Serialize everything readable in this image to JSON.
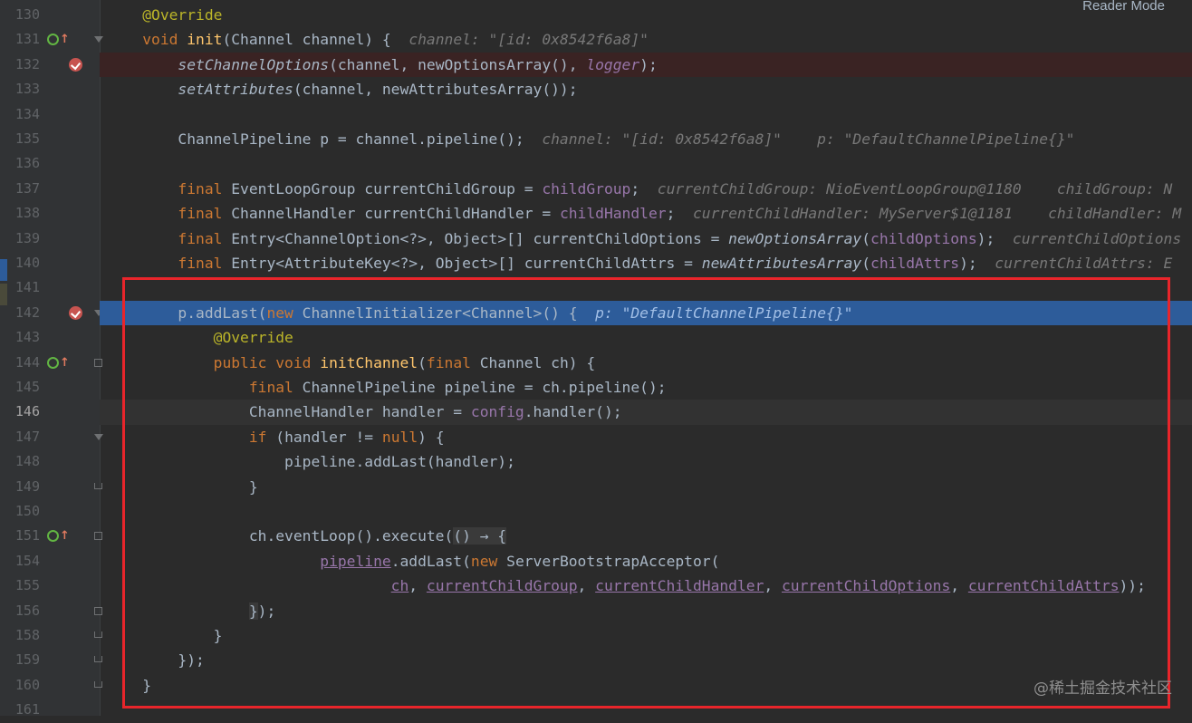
{
  "editor": {
    "reader_mode_label": "Reader Mode",
    "watermark": "@稀土掘金技术社区",
    "colors": {
      "background": "#2b2b2b",
      "keyword": "#cc7832",
      "annotation": "#bbb529",
      "method": "#ffc66d",
      "field": "#9876aa",
      "execution_line": "#2d5c9a",
      "red_box": "#e8252b"
    },
    "line_numbers": [
      "130",
      "131",
      "132",
      "133",
      "134",
      "135",
      "136",
      "137",
      "138",
      "139",
      "140",
      "141",
      "142",
      "143",
      "144",
      "145",
      "146",
      "147",
      "148",
      "149",
      "150",
      "151",
      "154",
      "155",
      "156",
      "158",
      "159",
      "160",
      "161"
    ],
    "lines": [
      [
        {
          "t": "    "
        },
        {
          "t": "@Override",
          "c": "ann"
        }
      ],
      [
        {
          "t": "    "
        },
        {
          "t": "void ",
          "c": "kw"
        },
        {
          "t": "init",
          "c": "fn"
        },
        {
          "t": "(Channel channel) {  "
        },
        {
          "t": "channel: \"[id: 0x8542f6a8]\"",
          "c": "hint"
        }
      ],
      [
        {
          "t": "        "
        },
        {
          "t": "setChannelOptions",
          "c": "it"
        },
        {
          "t": "(channel, newOptionsArray(), "
        },
        {
          "t": "logger",
          "c": "fld it"
        },
        {
          "t": ");"
        }
      ],
      [
        {
          "t": "        "
        },
        {
          "t": "setAttributes",
          "c": "it"
        },
        {
          "t": "(channel, newAttributesArray());"
        }
      ],
      [],
      [
        {
          "t": "        ChannelPipeline p = channel.pipeline();  "
        },
        {
          "t": "channel: \"[id: 0x8542f6a8]\"    p: \"DefaultChannelPipeline{}\"",
          "c": "hint"
        }
      ],
      [],
      [
        {
          "t": "        "
        },
        {
          "t": "final ",
          "c": "kw"
        },
        {
          "t": "EventLoopGroup currentChildGroup = "
        },
        {
          "t": "childGroup",
          "c": "fld"
        },
        {
          "t": ";  "
        },
        {
          "t": "currentChildGroup: NioEventLoopGroup@1180    childGroup: N",
          "c": "hint"
        }
      ],
      [
        {
          "t": "        "
        },
        {
          "t": "final ",
          "c": "kw"
        },
        {
          "t": "ChannelHandler currentChildHandler = "
        },
        {
          "t": "childHandler",
          "c": "fld"
        },
        {
          "t": ";  "
        },
        {
          "t": "currentChildHandler: MyServer$1@1181    childHandler: M",
          "c": "hint"
        }
      ],
      [
        {
          "t": "        "
        },
        {
          "t": "final ",
          "c": "kw"
        },
        {
          "t": "Entry<ChannelOption<?>, Object>[] currentChildOptions = "
        },
        {
          "t": "newOptionsArray",
          "c": "it"
        },
        {
          "t": "("
        },
        {
          "t": "childOptions",
          "c": "fld"
        },
        {
          "t": ");  "
        },
        {
          "t": "currentChildOptions",
          "c": "hint"
        }
      ],
      [
        {
          "t": "        "
        },
        {
          "t": "final ",
          "c": "kw"
        },
        {
          "t": "Entry<AttributeKey<?>, Object>[] currentChildAttrs = "
        },
        {
          "t": "newAttributesArray",
          "c": "it"
        },
        {
          "t": "("
        },
        {
          "t": "childAttrs",
          "c": "fld"
        },
        {
          "t": ");  "
        },
        {
          "t": "currentChildAttrs: E",
          "c": "hint"
        }
      ],
      [],
      [
        {
          "t": "        p.addLast("
        },
        {
          "t": "new ",
          "c": "kw"
        },
        {
          "t": "ChannelInitializer<Channel>() {  "
        },
        {
          "t": "p: \"DefaultChannelPipeline{}\"",
          "c": "hint-exec"
        }
      ],
      [
        {
          "t": "            "
        },
        {
          "t": "@Override",
          "c": "ann"
        }
      ],
      [
        {
          "t": "            "
        },
        {
          "t": "public void ",
          "c": "kw"
        },
        {
          "t": "initChannel",
          "c": "fn"
        },
        {
          "t": "("
        },
        {
          "t": "final ",
          "c": "kw"
        },
        {
          "t": "Channel ch) {"
        }
      ],
      [
        {
          "t": "                "
        },
        {
          "t": "final ",
          "c": "kw"
        },
        {
          "t": "ChannelPipeline pipeline = ch.pipeline();"
        }
      ],
      [
        {
          "t": "                ChannelHandler handler = "
        },
        {
          "t": "config",
          "c": "fld"
        },
        {
          "t": ".handler();"
        }
      ],
      [
        {
          "t": "                "
        },
        {
          "t": "if ",
          "c": "kw"
        },
        {
          "t": "(handler != "
        },
        {
          "t": "null",
          "c": "kw"
        },
        {
          "t": ") {"
        }
      ],
      [
        {
          "t": "                    pipeline.addLast(handler);"
        }
      ],
      [
        {
          "t": "                }"
        }
      ],
      [],
      [
        {
          "t": "                ch.eventLoop().execute("
        },
        {
          "t": "() → {",
          "c": "lam"
        }
      ],
      [
        {
          "t": "                        "
        },
        {
          "t": "pipeline",
          "c": "fld ul"
        },
        {
          "t": ".addLast("
        },
        {
          "t": "new ",
          "c": "kw"
        },
        {
          "t": "ServerBootstrapAcceptor("
        }
      ],
      [
        {
          "t": "                                "
        },
        {
          "t": "ch",
          "c": "fld ul"
        },
        {
          "t": ", "
        },
        {
          "t": "currentChildGroup",
          "c": "fld ul"
        },
        {
          "t": ", "
        },
        {
          "t": "currentChildHandler",
          "c": "fld ul"
        },
        {
          "t": ", "
        },
        {
          "t": "currentChildOptions",
          "c": "fld ul"
        },
        {
          "t": ", "
        },
        {
          "t": "currentChildAttrs",
          "c": "fld ul"
        },
        {
          "t": "));"
        }
      ],
      [
        {
          "t": "                "
        },
        {
          "t": "}",
          "c": "lam"
        },
        {
          "t": ");"
        }
      ],
      [
        {
          "t": "            }"
        }
      ],
      [
        {
          "t": "        });"
        }
      ],
      [
        {
          "t": "    }"
        }
      ],
      []
    ]
  }
}
